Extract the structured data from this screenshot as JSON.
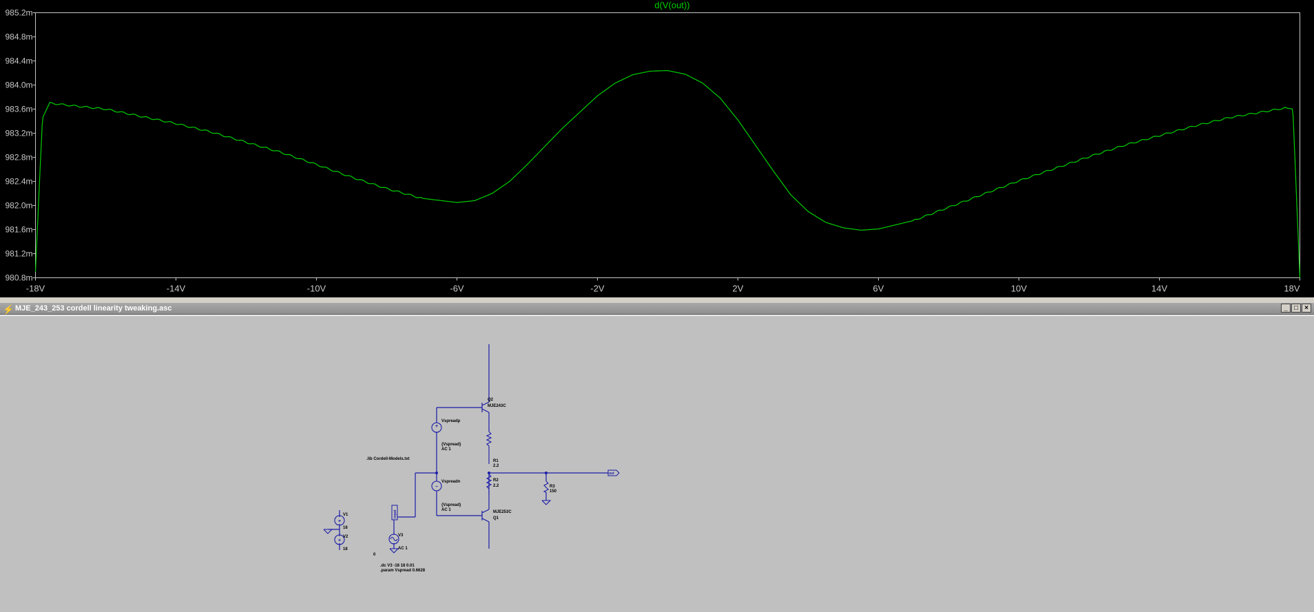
{
  "plot": {
    "trace_label": "d(V(out))",
    "trace_color": "#00d000",
    "axis_color": "#c8c8c8",
    "bg_color": "#000000",
    "y_ticks": [
      "985.2m",
      "984.8m",
      "984.4m",
      "984.0m",
      "983.6m",
      "983.2m",
      "982.8m",
      "982.4m",
      "982.0m",
      "981.6m",
      "981.2m",
      "980.8m"
    ],
    "x_ticks": [
      "-18V",
      "-14V",
      "-10V",
      "-6V",
      "-2V",
      "2V",
      "6V",
      "10V",
      "14V",
      "18V"
    ]
  },
  "chart_data": {
    "type": "line",
    "xlim": [
      -18,
      18
    ],
    "ylim": [
      0.9808,
      0.9852
    ],
    "series": [
      {
        "name": "d(V(out))",
        "x": [
          -18.0,
          -17.9,
          -17.8,
          -17.6,
          -17.0,
          -16.0,
          -15.0,
          -14.0,
          -13.0,
          -12.0,
          -11.0,
          -10.0,
          -9.0,
          -8.0,
          -7.0,
          -6.0,
          -5.5,
          -5.0,
          -4.5,
          -4.0,
          -3.5,
          -3.0,
          -2.5,
          -2.0,
          -1.5,
          -1.0,
          -0.5,
          0.0,
          0.5,
          1.0,
          1.5,
          2.0,
          2.5,
          3.0,
          3.5,
          4.0,
          4.5,
          5.0,
          5.5,
          6.0,
          7.0,
          8.0,
          9.0,
          10.0,
          11.0,
          12.0,
          13.0,
          14.0,
          15.0,
          16.0,
          17.0,
          17.6,
          17.8,
          17.9,
          18.0
        ],
        "y": [
          0.9809,
          0.9822,
          0.98345,
          0.9837,
          0.98366,
          0.9836,
          0.98348,
          0.98336,
          0.98322,
          0.98305,
          0.98288,
          0.98268,
          0.98247,
          0.98228,
          0.98212,
          0.98205,
          0.98208,
          0.9822,
          0.9824,
          0.98268,
          0.98298,
          0.98328,
          0.98355,
          0.98382,
          0.98403,
          0.98417,
          0.98423,
          0.98424,
          0.98418,
          0.98403,
          0.98378,
          0.98342,
          0.983,
          0.98258,
          0.98218,
          0.9819,
          0.98172,
          0.98163,
          0.98159,
          0.98161,
          0.98175,
          0.98197,
          0.98219,
          0.98241,
          0.98261,
          0.98281,
          0.983,
          0.98316,
          0.98332,
          0.98346,
          0.98356,
          0.98362,
          0.9836,
          0.9822,
          0.9808
        ]
      }
    ]
  },
  "schematic": {
    "window_title": "MJE_243_253 cordell linearity tweaking.asc",
    "wire_color": "#1a1aa8",
    "labels": {
      "q2_name": "Q2",
      "q2_model": "MJE243C",
      "q1_name": "Q1",
      "q1_model": "MJE253C",
      "vspreadp_name": "Vspreadp",
      "vspreadp_val": "{Vspread}",
      "vspreadp_ac": "AC 1",
      "vspreadn_name": "Vspreadn",
      "vspreadn_val": "{Vspread}",
      "vspreadn_ac": "AC 1",
      "r1_name": "R1",
      "r1_val": "2.2",
      "r2_name": "R2",
      "r2_val": "2.2",
      "r3_name": "R3",
      "r3_val": "150",
      "lib": ".lib Cordell-Models.txt",
      "v1_name": "V1",
      "v1_val": "18",
      "v2_name": "V2",
      "v2_val": "18",
      "v3_name": "V3",
      "v3_ac": "AC 1",
      "input_label": "input",
      "out_label": "out",
      "zero": "0",
      "dc_cmd": ".dc V3 -18 18 0.01",
      "param_cmd": ".param Vspread 0.6628"
    }
  }
}
